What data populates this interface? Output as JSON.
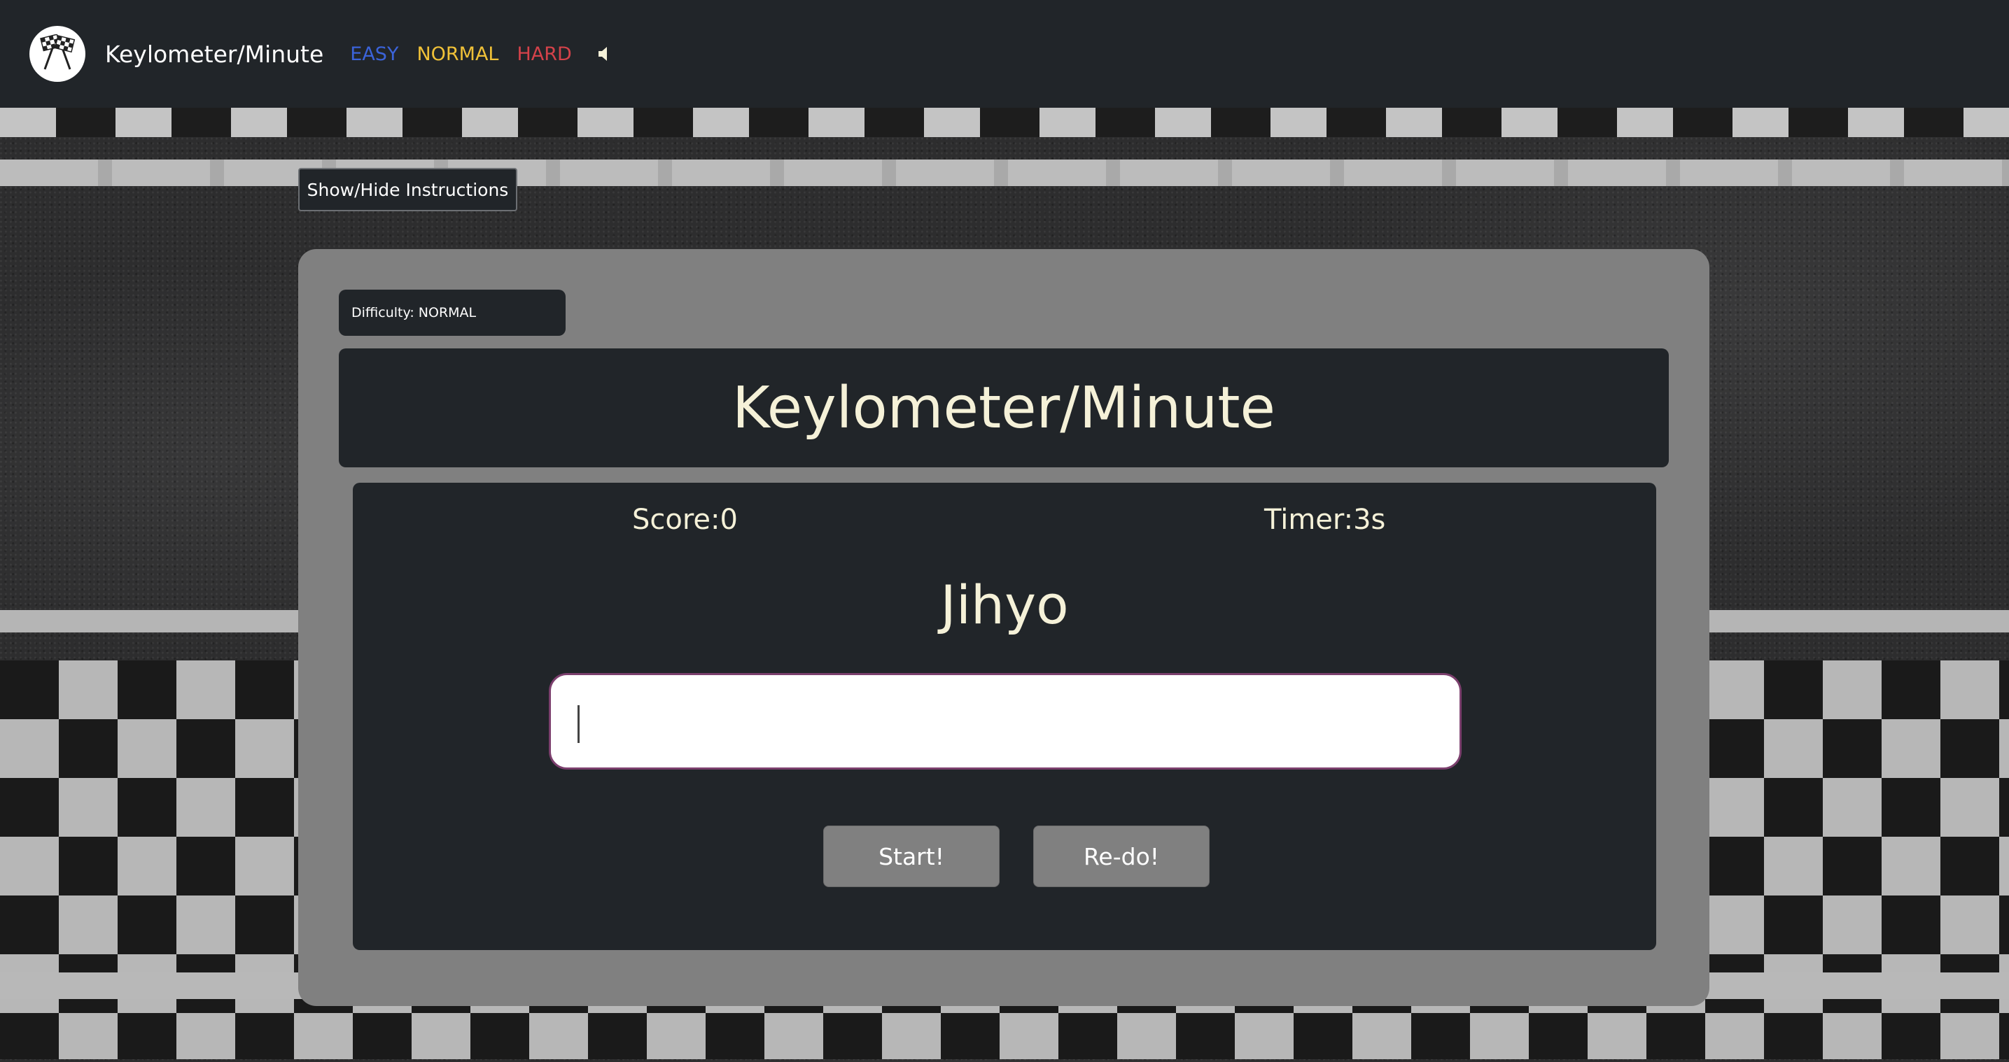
{
  "navbar": {
    "logo_icon": "checkered-flags-icon",
    "brand": "Keylometer/Minute",
    "difficulty_links": [
      {
        "label": "EASY",
        "color": "#3b63d9"
      },
      {
        "label": "NORMAL",
        "color": "#f0c138"
      },
      {
        "label": "HARD",
        "color": "#d4424a"
      }
    ],
    "sound_icon": "speaker-icon"
  },
  "instructions_toggle": "Show/Hide Instructions",
  "game": {
    "difficulty_label": "Difficulty: NORMAL",
    "title": "Keylometer/Minute",
    "score": "Score:0",
    "timer": "Timer:3s",
    "current_word": "Jihyo",
    "input_value": "",
    "start_label": "Start!",
    "redo_label": "Re-do!"
  },
  "colors": {
    "navbar_bg": "#212529",
    "panel_bg": "#808080",
    "text_cream": "#f5f1d8"
  }
}
